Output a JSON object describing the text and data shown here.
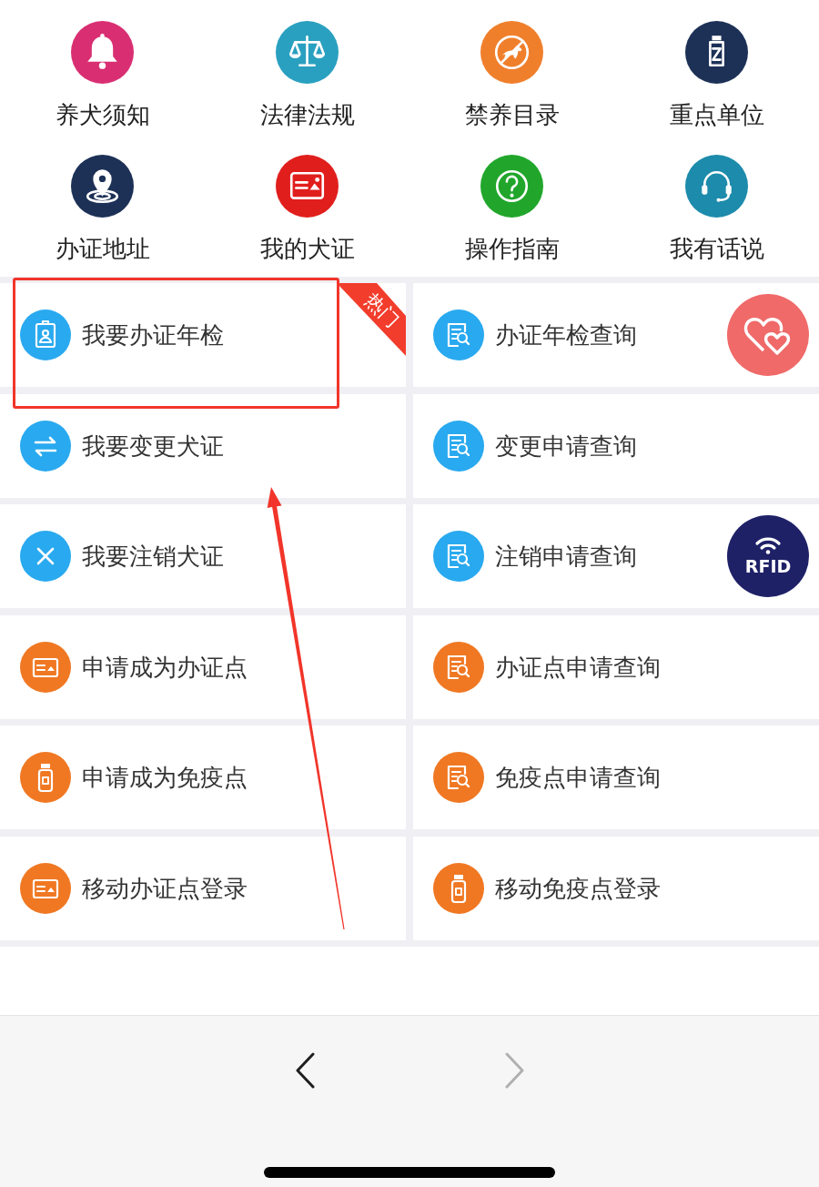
{
  "quick_links": [
    {
      "label": "养犬须知"
    },
    {
      "label": "法律法规"
    },
    {
      "label": "禁养目录"
    },
    {
      "label": "重点单位"
    },
    {
      "label": "办证地址"
    },
    {
      "label": "我的犬证"
    },
    {
      "label": "操作指南"
    },
    {
      "label": "我有话说"
    }
  ],
  "services": [
    {
      "label": "我要办证年检",
      "badge": "热门"
    },
    {
      "label": "办证年检查询"
    },
    {
      "label": "我要变更犬证"
    },
    {
      "label": "变更申请查询"
    },
    {
      "label": "我要注销犬证"
    },
    {
      "label": "注销申请查询"
    },
    {
      "label": "申请成为办证点"
    },
    {
      "label": "办证点申请查询"
    },
    {
      "label": "申请成为免疫点"
    },
    {
      "label": "免疫点申请查询"
    },
    {
      "label": "移动办证点登录"
    },
    {
      "label": "移动免疫点登录"
    }
  ],
  "rfid_button": {
    "label": "RFID"
  },
  "navigation": {
    "back": {
      "disabled": false
    },
    "forward": {
      "disabled": true
    }
  }
}
